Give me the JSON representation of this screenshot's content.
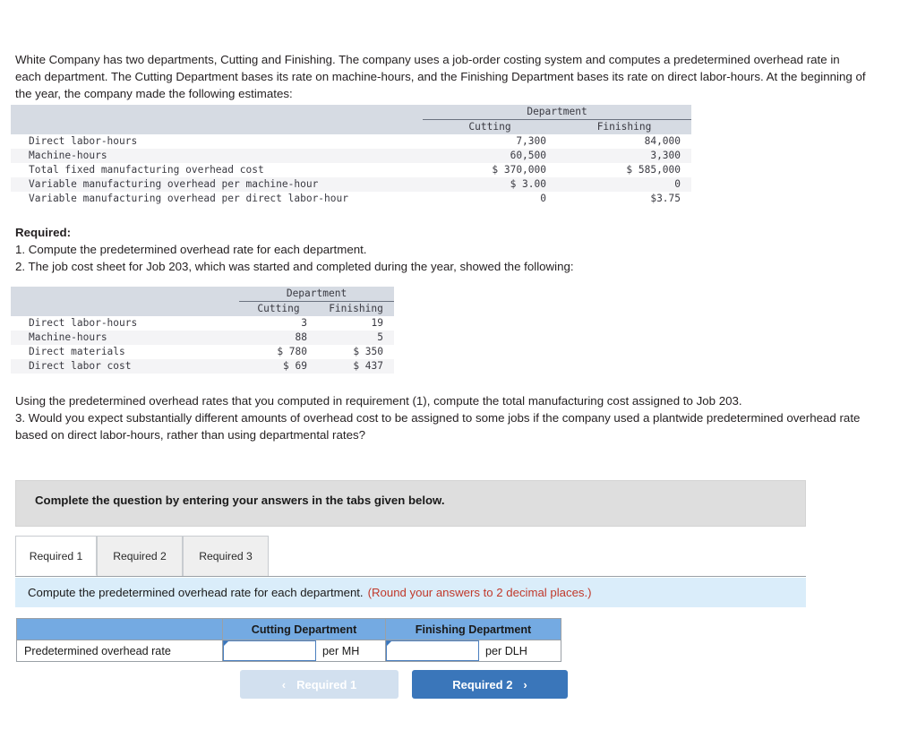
{
  "intro_paragraph": "White Company has two departments, Cutting and Finishing. The company uses a job-order costing system and computes a predetermined overhead rate in each department. The Cutting Department bases its rate on machine-hours, and the Finishing Department bases its rate on direct labor-hours. At the beginning of the year, the company made the following estimates:",
  "estimates_table": {
    "group_header": "Department",
    "columns": [
      "Cutting",
      "Finishing"
    ],
    "rows": [
      {
        "label": "Direct labor-hours",
        "cutting": "7,300",
        "finishing": "84,000"
      },
      {
        "label": "Machine-hours",
        "cutting": "60,500",
        "finishing": "3,300"
      },
      {
        "label": "Total fixed manufacturing overhead cost",
        "cutting": "$ 370,000",
        "finishing": "$ 585,000"
      },
      {
        "label": "Variable manufacturing overhead per machine-hour",
        "cutting": "$ 3.00",
        "finishing": "0"
      },
      {
        "label": "Variable manufacturing overhead per direct labor-hour",
        "cutting": "0",
        "finishing": "$3.75"
      }
    ]
  },
  "required_heading": "Required:",
  "required_item_1": "1. Compute the predetermined overhead rate for each department.",
  "required_item_2": "2. The job cost sheet for Job 203, which was started and completed during the year, showed the following:",
  "jobcost_table": {
    "group_header": "Department",
    "columns": [
      "Cutting",
      "Finishing"
    ],
    "rows": [
      {
        "label": "Direct labor-hours",
        "cutting": "3",
        "finishing": "19"
      },
      {
        "label": "Machine-hours",
        "cutting": "88",
        "finishing": "5"
      },
      {
        "label": "Direct materials",
        "cutting": "$ 780",
        "finishing": "$ 350"
      },
      {
        "label": "Direct labor cost",
        "cutting": "$ 69",
        "finishing": "$ 437"
      }
    ]
  },
  "mid_paragraph": "Using the predetermined overhead rates that you computed in requirement (1), compute the total manufacturing cost assigned to Job 203.",
  "required_item_3": "3. Would you expect substantially different amounts of overhead cost to be assigned to some jobs if the company used a plantwide predetermined overhead rate based on direct labor-hours, rather than using departmental rates?",
  "complete_banner": "Complete the question by entering your answers in the tabs given below.",
  "tabs": [
    {
      "label": "Required 1",
      "active": true
    },
    {
      "label": "Required 2",
      "active": false
    },
    {
      "label": "Required 3",
      "active": false
    }
  ],
  "blue_instruction": {
    "main": "Compute the predetermined overhead rate for each department.",
    "rounding_note": "(Round your answers to 2 decimal places.)"
  },
  "answer_table": {
    "header_blank": "",
    "header_cutting": "Cutting Department",
    "header_finishing": "Finishing Department",
    "row_label": "Predetermined overhead rate",
    "cutting_value": "",
    "cutting_unit": "per MH",
    "finishing_value": "",
    "finishing_unit": "per DLH"
  },
  "nav": {
    "prev_label": "Required 1",
    "prev_chevron": "‹",
    "next_label": "Required 2",
    "next_chevron": "›"
  },
  "colors": {
    "table_band": "#d6dbe3",
    "answer_header_blue": "#74aae2",
    "instruction_blue": "#daedfa",
    "banner_gray": "#dedede",
    "red_note": "#c0392b",
    "primary_button": "#3a76ba",
    "disabled_button": "#d2e0ef"
  }
}
